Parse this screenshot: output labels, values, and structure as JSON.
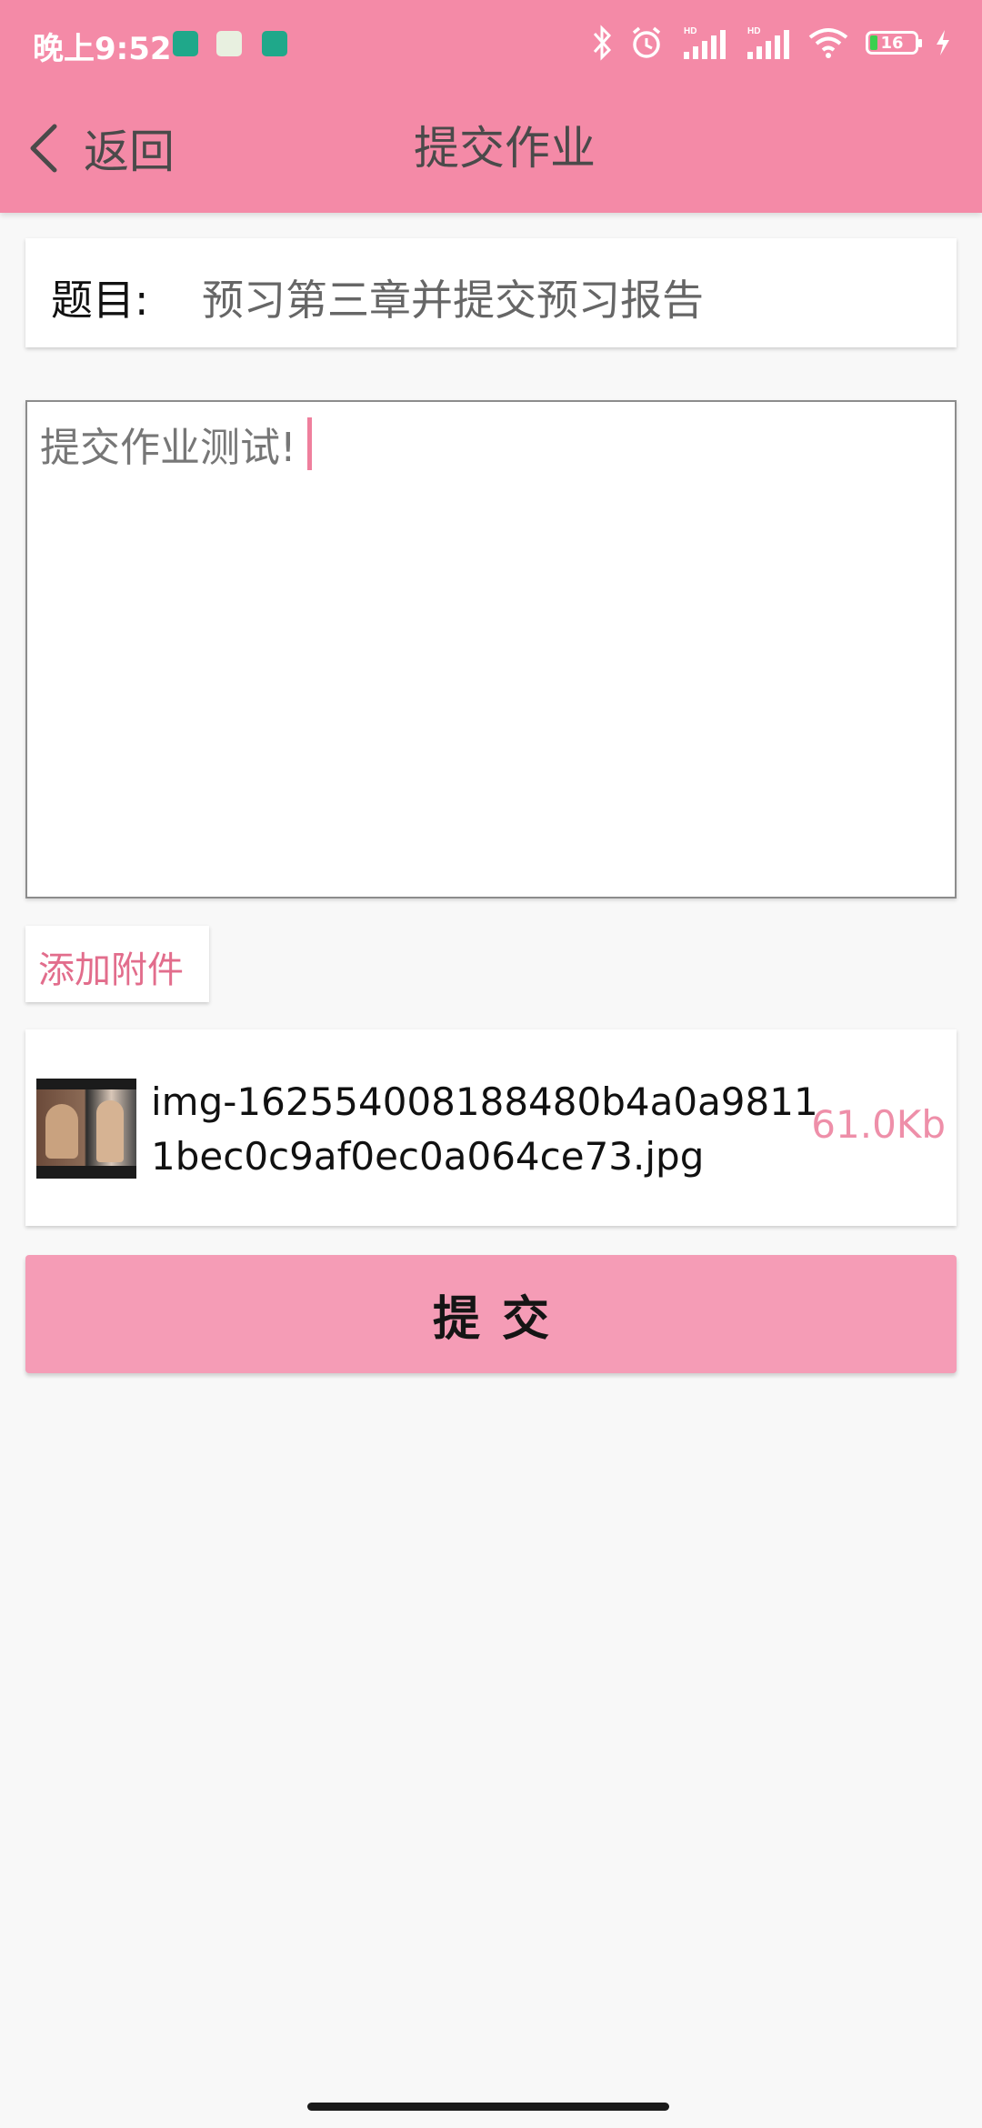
{
  "status_bar": {
    "time": "晚上9:52",
    "battery_level": "16",
    "icons": [
      "app-icon-green",
      "app-icon-chart",
      "app-icon-green",
      "bluetooth-icon",
      "alarm-icon",
      "signal-hd-icon",
      "signal-hd-icon",
      "wifi-icon",
      "battery-icon",
      "charging-icon"
    ]
  },
  "nav": {
    "back_label": "返回",
    "title": "提交作业"
  },
  "topic": {
    "label": "题目:",
    "value": "预习第三章并提交预习报告"
  },
  "content": {
    "value": "提交作业测试!"
  },
  "attach": {
    "label": "添加附件"
  },
  "attachment": {
    "file_name": "img-162554008188480b4a0a98111bec0c9af0ec0a064ce73.jpg",
    "file_size": "61.0Kb"
  },
  "submit": {
    "label": "提交"
  },
  "colors": {
    "primary": "#f48aa7",
    "button": "#f59cb6",
    "accent_text": "#e26d8c",
    "caret": "#ef7f9d"
  }
}
